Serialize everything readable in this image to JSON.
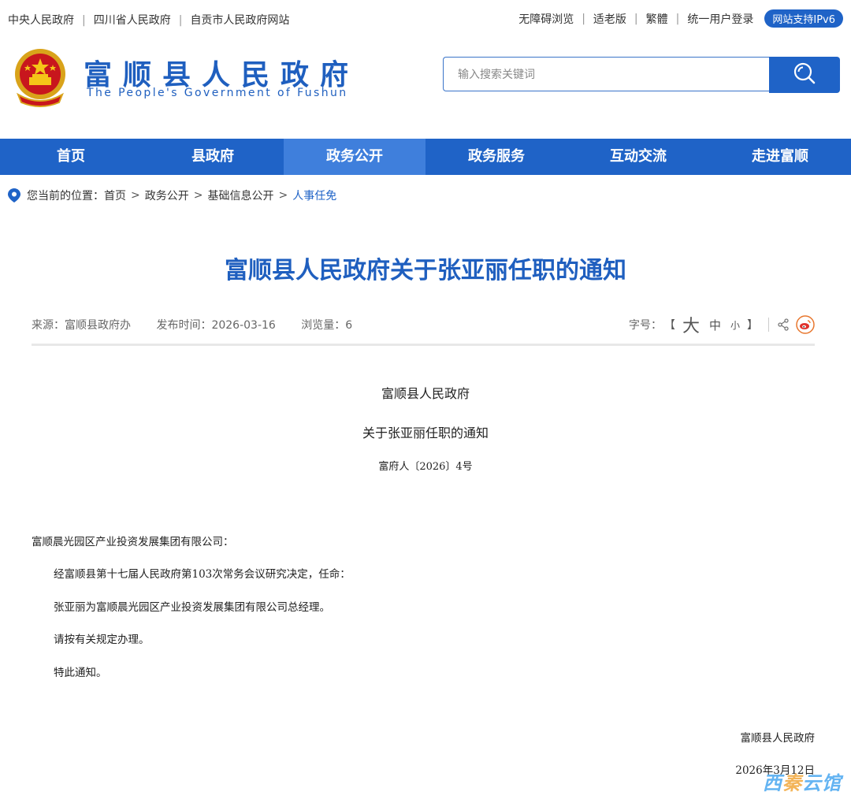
{
  "topbar": {
    "links_left": [
      "中央人民政府",
      "四川省人民政府",
      "自贡市人民政府网站"
    ],
    "links_right": [
      "无障碍浏览",
      "适老版",
      "繁體",
      "统一用户登录"
    ],
    "ipv6_badge": "网站支持IPv6"
  },
  "header": {
    "logo_cn": "富顺县人民政府",
    "logo_en": "The People's Government of Fushun",
    "search_placeholder": "输入搜索关键词",
    "search_icon": "search-icon"
  },
  "nav": {
    "items": [
      "首页",
      "县政府",
      "政务公开",
      "政务服务",
      "互动交流",
      "走进富顺"
    ],
    "active_index": 2
  },
  "breadcrumb": {
    "prefix": "您当前的位置：",
    "items": [
      "首页",
      "政务公开",
      "基础信息公开",
      "人事任免"
    ]
  },
  "article": {
    "title": "富顺县人民政府关于张亚丽任职的通知",
    "source": "来源：富顺县政府办",
    "publish_time": "发布时间：2026-03-16",
    "views": "浏览量：6",
    "font_size_label": "字号：",
    "font_big": "大",
    "font_mid": "中",
    "font_small": "小",
    "doc_issuer": "富顺县人民政府",
    "doc_subject": "关于张亚丽任职的通知",
    "doc_number": "富府人〔2026〕4号",
    "addressee": "富顺晨光园区产业投资发展集团有限公司：",
    "para1": "经富顺县第十七届人民政府第103次常务会议研究决定，任命：",
    "para2": "张亚丽为富顺晨光园区产业投资发展集团有限公司总经理。",
    "para3": "请按有关规定办理。",
    "para4": "特此通知。",
    "sign_org": "富顺县人民政府",
    "sign_date": "2026年3月12日"
  },
  "colors": {
    "brand_blue": "#1f63c7",
    "nav_active": "#3f7fdc"
  }
}
